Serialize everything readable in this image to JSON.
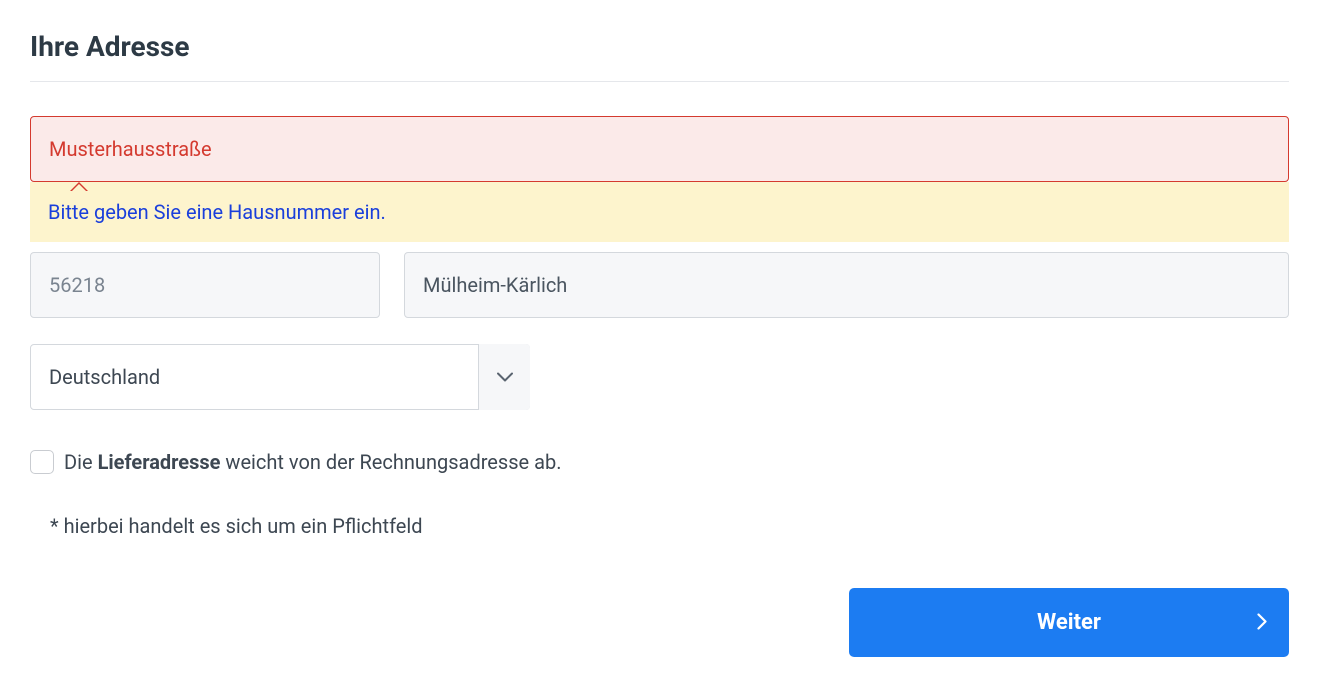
{
  "section": {
    "title": "Ihre Adresse"
  },
  "fields": {
    "street": {
      "value": "Musterhausstraße"
    },
    "error_message": "Bitte geben Sie eine Hausnummer ein.",
    "postal": {
      "value": "56218"
    },
    "city": {
      "value": "Mülheim-Kärlich"
    },
    "country": {
      "selected": "Deutschland"
    }
  },
  "checkbox": {
    "pre": "Die ",
    "bold": "Lieferadresse",
    "post": " weicht von der Rechnungsadresse ab."
  },
  "required_note": "* hierbei handelt es sich um ein Pflichtfeld",
  "buttons": {
    "continue": "Weiter"
  }
}
